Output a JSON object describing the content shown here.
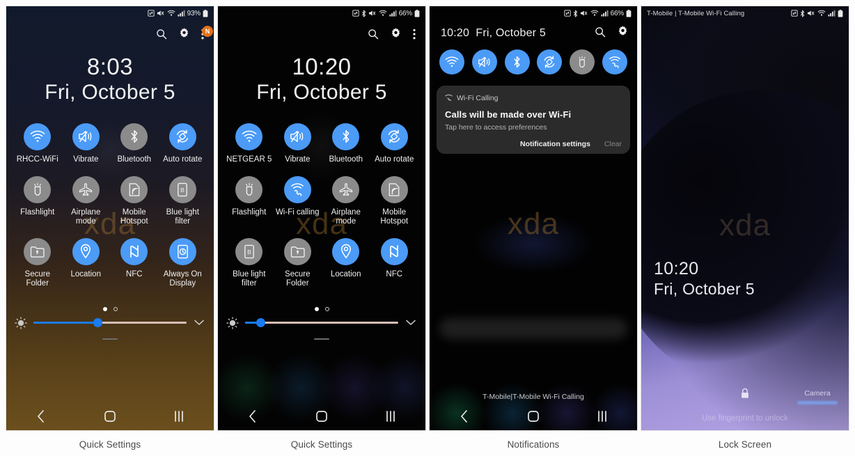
{
  "captions": [
    "Quick Settings",
    "Quick Settings",
    "Notifications",
    "Lock Screen"
  ],
  "colors": {
    "accent_on": "#4b9bf7",
    "toggle_off": "#8b8b8b",
    "badge": "#e2701a",
    "slider": "#1a7bf2",
    "watermark": "#aa7832"
  },
  "watermark": "xda",
  "panel1": {
    "status_bar": {
      "battery": "93%",
      "icons": [
        "nfc-icon",
        "mute-icon",
        "wifi-icon",
        "signal-icon",
        "battery-icon"
      ]
    },
    "actions": {
      "search": "search-icon",
      "settings": "gear-icon",
      "more": "more-vert-icon",
      "badge": "N"
    },
    "clock": {
      "time": "8:03",
      "date": "Fri, October 5"
    },
    "tiles": [
      {
        "label": "RHCC-WiFi",
        "icon": "wifi-icon",
        "state": "on"
      },
      {
        "label": "Vibrate",
        "icon": "vibrate-icon",
        "state": "on"
      },
      {
        "label": "Bluetooth",
        "icon": "bluetooth-icon",
        "state": "off"
      },
      {
        "label": "Auto rotate",
        "icon": "auto-rotate-icon",
        "state": "on"
      },
      {
        "label": "Flashlight",
        "icon": "flashlight-icon",
        "state": "off"
      },
      {
        "label": "Airplane mode",
        "icon": "airplane-icon",
        "state": "off"
      },
      {
        "label": "Mobile Hotspot",
        "icon": "hotspot-icon",
        "state": "off"
      },
      {
        "label": "Blue light filter",
        "icon": "blue-light-icon",
        "state": "off"
      },
      {
        "label": "Secure Folder",
        "icon": "secure-folder-icon",
        "state": "off"
      },
      {
        "label": "Location",
        "icon": "location-icon",
        "state": "on"
      },
      {
        "label": "NFC",
        "icon": "nfc-icon",
        "state": "on"
      },
      {
        "label": "Always On Display",
        "icon": "aod-icon",
        "state": "on"
      }
    ],
    "pager": {
      "pages": 2,
      "active": 1
    },
    "brightness": {
      "percent": 42
    },
    "navbar": [
      "back-icon",
      "home-icon",
      "recents-icon"
    ]
  },
  "panel2": {
    "status_bar": {
      "battery": "66%",
      "icons": [
        "nfc-icon",
        "bluetooth-icon",
        "mute-icon",
        "wifi-icon",
        "signal-icon",
        "battery-icon"
      ]
    },
    "actions": {
      "search": "search-icon",
      "settings": "gear-icon",
      "more": "more-vert-icon"
    },
    "clock": {
      "time": "10:20",
      "date": "Fri, October 5"
    },
    "tiles": [
      {
        "label": "NETGEAR 5",
        "icon": "wifi-icon",
        "state": "on"
      },
      {
        "label": "Vibrate",
        "icon": "vibrate-icon",
        "state": "on"
      },
      {
        "label": "Bluetooth",
        "icon": "bluetooth-icon",
        "state": "on"
      },
      {
        "label": "Auto rotate",
        "icon": "auto-rotate-icon",
        "state": "on"
      },
      {
        "label": "Flashlight",
        "icon": "flashlight-icon",
        "state": "off"
      },
      {
        "label": "Wi-Fi calling",
        "icon": "wifi-calling-icon",
        "state": "on"
      },
      {
        "label": "Airplane mode",
        "icon": "airplane-icon",
        "state": "off"
      },
      {
        "label": "Mobile Hotspot",
        "icon": "hotspot-icon",
        "state": "off"
      },
      {
        "label": "Blue light filter",
        "icon": "blue-light-icon",
        "state": "off"
      },
      {
        "label": "Secure Folder",
        "icon": "secure-folder-icon",
        "state": "off"
      },
      {
        "label": "Location",
        "icon": "location-icon",
        "state": "on"
      },
      {
        "label": "NFC",
        "icon": "nfc-icon",
        "state": "on"
      }
    ],
    "pager": {
      "pages": 2,
      "active": 1
    },
    "brightness": {
      "percent": 10
    },
    "navbar": [
      "back-icon",
      "home-icon",
      "recents-icon"
    ]
  },
  "panel3": {
    "status_bar": {
      "battery": "66%",
      "icons": [
        "nfc-icon",
        "bluetooth-icon",
        "mute-icon",
        "wifi-icon",
        "signal-icon",
        "battery-icon"
      ]
    },
    "header": {
      "time": "10:20",
      "date": "Fri, October 5",
      "search": "search-icon",
      "settings": "gear-icon"
    },
    "quick_toggles": [
      {
        "icon": "wifi-icon",
        "state": "on"
      },
      {
        "icon": "vibrate-icon",
        "state": "on"
      },
      {
        "icon": "bluetooth-icon",
        "state": "on"
      },
      {
        "icon": "auto-rotate-icon",
        "state": "on"
      },
      {
        "icon": "flashlight-icon",
        "state": "off"
      },
      {
        "icon": "wifi-calling-icon",
        "state": "on"
      }
    ],
    "notification": {
      "app": "Wi-Fi Calling",
      "app_icon": "wifi-calling-icon",
      "title": "Calls will be made over Wi-Fi",
      "subtitle": "Tap here to access preferences",
      "action_primary": "Notification settings",
      "action_secondary": "Clear"
    },
    "carrier": "T-Mobile|T-Mobile Wi-Fi Calling",
    "navbar": [
      "back-icon",
      "home-icon",
      "recents-icon"
    ]
  },
  "panel4": {
    "status_bar": {
      "carrier": "T-Mobile | T-Mobile Wi-Fi Calling",
      "icons": [
        "nfc-icon",
        "bluetooth-icon",
        "mute-icon",
        "wifi-icon",
        "signal-icon",
        "battery-icon"
      ]
    },
    "clock": {
      "time": "10:20",
      "date": "Fri, October 5"
    },
    "lock_icon": "lock-icon",
    "camera_label": "Camera",
    "hint": "Use fingerprint to unlock"
  }
}
